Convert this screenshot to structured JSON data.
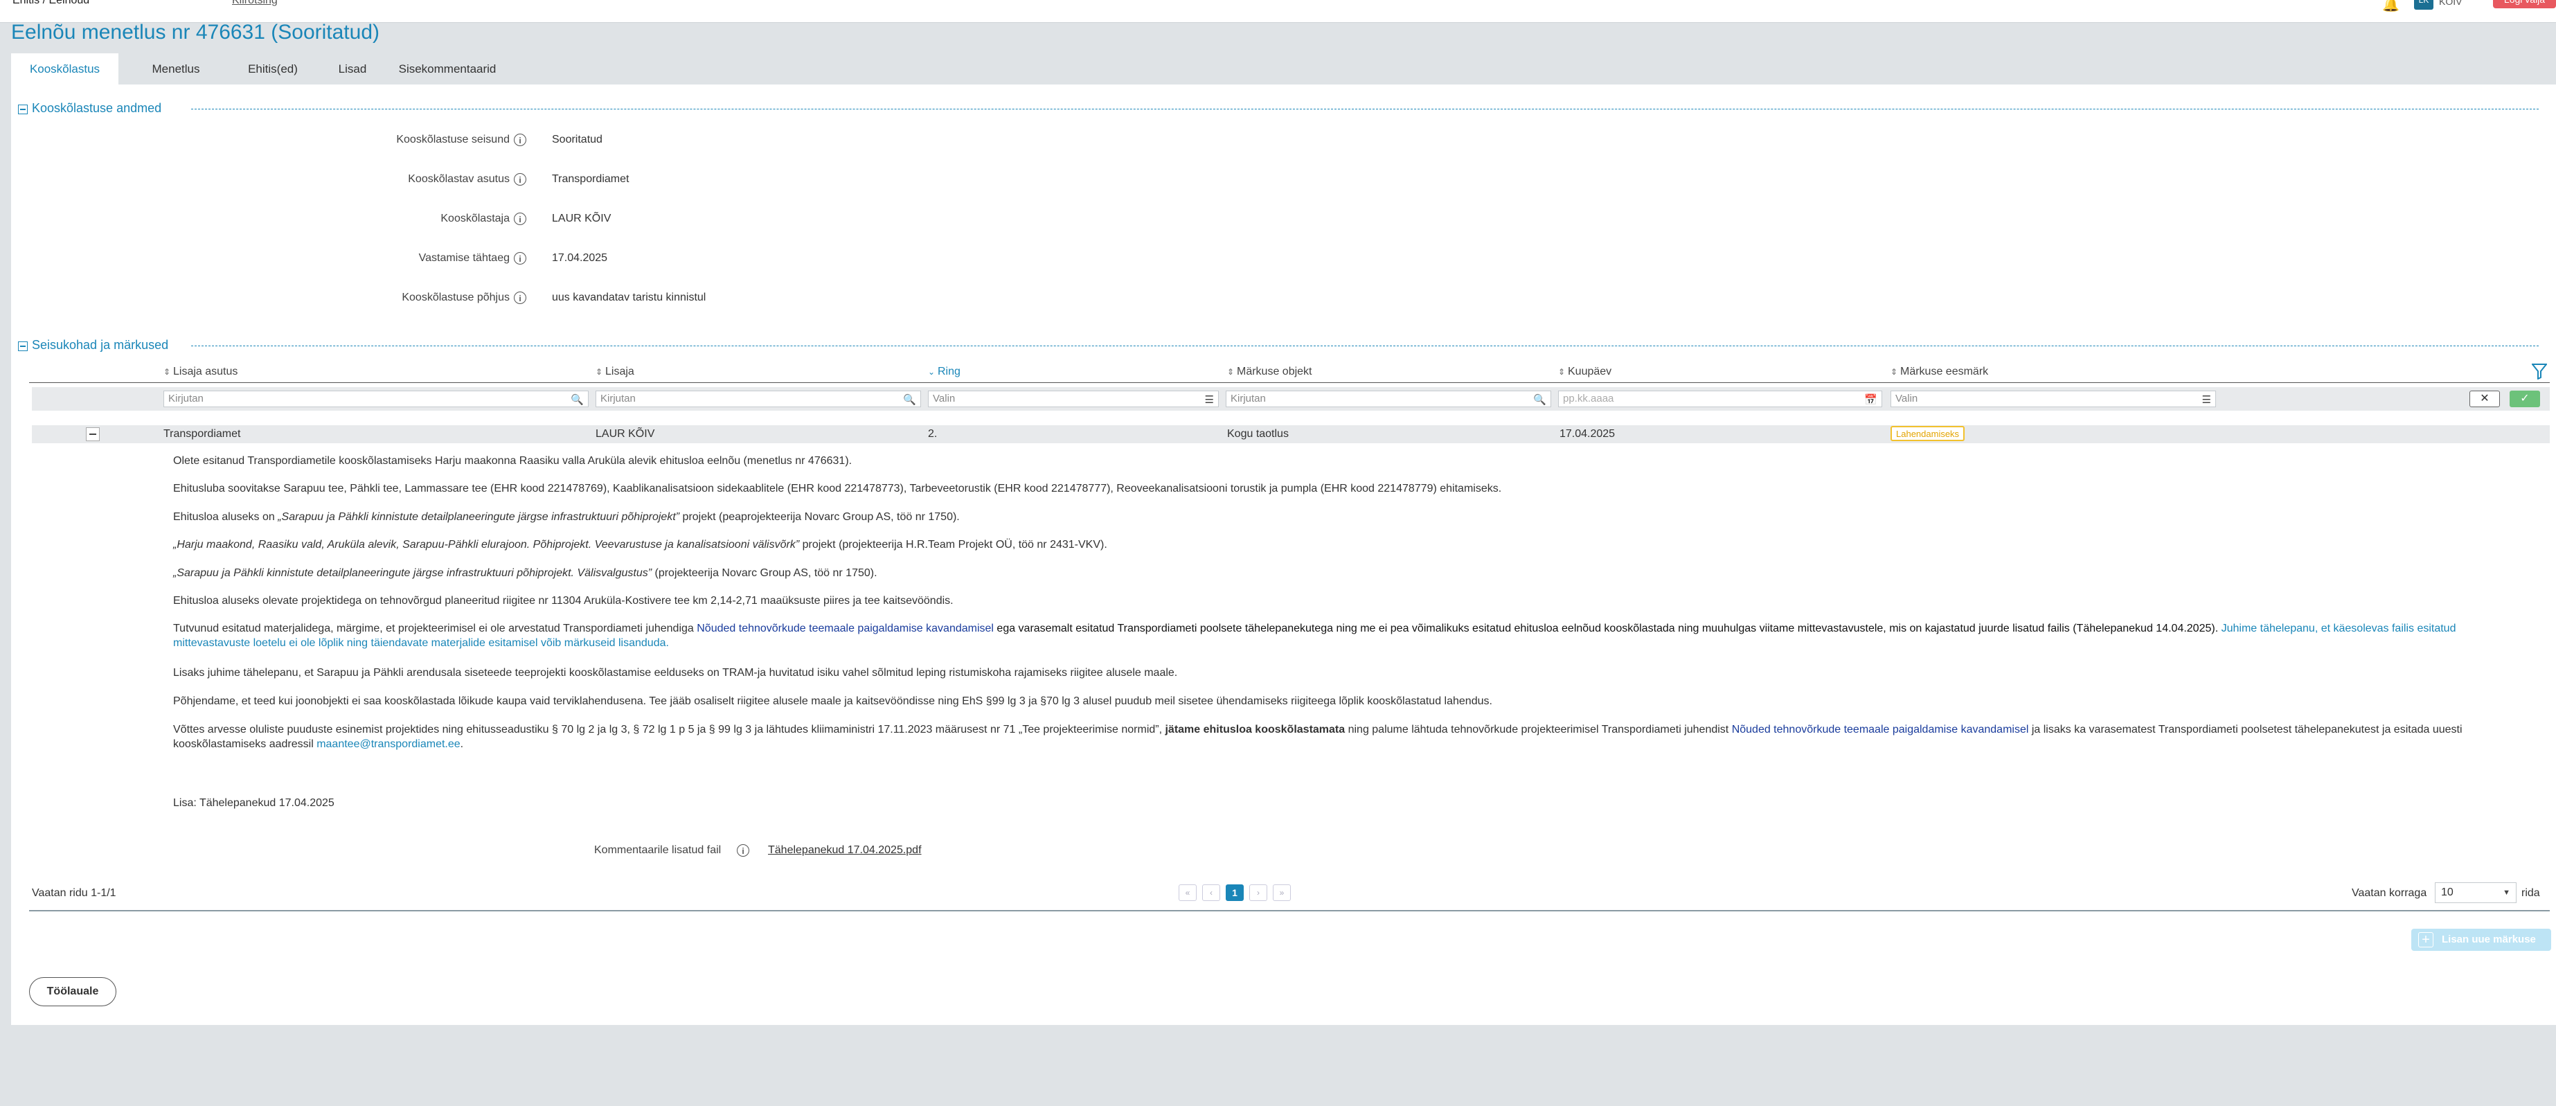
{
  "topbar": {
    "brand": "Ehitis / Eelnõud",
    "search": "Kiirotsing",
    "avatar_initials": "LK",
    "user": "KÕIV",
    "logout": "Logi välja"
  },
  "page": {
    "title": "Eelnõu menetlus nr 476631 (Sooritatud)"
  },
  "tabs": [
    "Kooskõlastus",
    "Menetlus",
    "Ehitis(ed)",
    "Lisad",
    "Sisekommentaarid"
  ],
  "coordination": {
    "section_title": "Kooskõlastuse andmed",
    "fields": [
      {
        "label": "Kooskõlastuse seisund",
        "value": "Sooritatud"
      },
      {
        "label": "Kooskõlastav asutus",
        "value": "Transpordiamet"
      },
      {
        "label": "Kooskõlastaja",
        "value": "LAUR KÕIV"
      },
      {
        "label": "Vastamise tähtaeg",
        "value": "17.04.2025"
      },
      {
        "label": "Kooskõlastuse põhjus",
        "value": "uus kavandatav taristu kinnistul"
      }
    ]
  },
  "remarks": {
    "section_title": "Seisukohad ja märkused",
    "columns": [
      "Lisaja asutus",
      "Lisaja",
      "Ring",
      "Märkuse objekt",
      "Kuupäev",
      "Märkuse eesmärk"
    ],
    "filters": {
      "institution": "Kirjutan",
      "author": "Kirjutan",
      "round": "Valin",
      "object": "Kirjutan",
      "date": "pp.kk.aaaa",
      "purpose": "Valin"
    },
    "row": {
      "institution": "Transpordiamet",
      "author": "LAUR KÕIV",
      "round": "2.",
      "object": "Kogu taotlus",
      "date": "17.04.2025",
      "purpose": "Lahendamiseks"
    },
    "body": {
      "p1": "Olete esitanud Transpordiametile kooskõlastamiseks Harju maakonna Raasiku valla Aruküla alevik ehitusloa eelnõu (menetlus nr 476631).",
      "p2": "Ehitusluba soovitakse Sarapuu tee, Pähkli tee, Lammassare tee (EHR kood 221478769), Kaablikanalisatsioon sidekaablitele (EHR kood 221478773), Tarbeveetorustik (EHR kood 221478777), Reoveekanalisatsiooni torustik ja pumpla (EHR kood 221478779) ehitamiseks.",
      "p3a": "Ehitusloa aluseks on ",
      "p3b": "„Sarapuu ja Pähkli kinnistute detailplaneeringute järgse infrastruktuuri põhiprojekt”",
      "p3c": " projekt (peaprojekteerija Novarc Group AS, töö nr 1750).",
      "p4a": "„Harju maakond, Raasiku vald, Aruküla alevik, Sarapuu-Pähkli elurajoon. Põhiprojekt. Veevarustuse ja kanalisatsiooni välisvõrk”",
      "p4b": " projekt (projekteerija H.R.Team Projekt OÜ, töö nr 2431-VKV).",
      "p5a": "„Sarapuu ja Pähkli kinnistute detailplaneeringute järgse infrastruktuuri põhiprojekt. Välisvalgustus”",
      "p5b": " (projekteerija Novarc Group AS, töö nr 1750).",
      "p6": "Ehitusloa aluseks olevate projektidega on tehnovõrgud planeeritud riigitee nr 11304 Aruküla-Kostivere tee km 2,14-2,71 maaüksuste piires ja tee kaitsevööndis.",
      "p7a": "Tutvunud esitatud materjalidega, märgime, et projekteerimisel ei ole arvestatud Transpordiameti juhendiga ",
      "p7b": "Nõuded tehnovõrkude teemaale paigaldamise kavandamisel",
      "p7c": " ega varasemalt esitatud Transpordiameti poolsete tähelepanekutega ning me ei pea võimalikuks esitatud ehitusloa eelnõud kooskõlastada ning muuhulgas viitame mittevastavustele, mis on kajastatud juurde lisatud failis (Tähelepanekud 14.04.2025).",
      "p7d": " Juhime tähelepanu, et käesolevas failis esitatud mittevastavuste loetelu ei ole lõplik ning täiendavate materjalide esitamisel võib märkuseid lisanduda.",
      "p8": "Lisaks juhime tähelepanu, et Sarapuu ja Pähkli arendusala siseteede teeprojekti kooskõlastamise eelduseks on TRAM-ja huvitatud isiku vahel sõlmitud leping ristumiskoha rajamiseks riigitee alusele maale.",
      "p9": "Põhjendame, et teed kui joonobjekti ei saa kooskõlastada lõikude kaupa vaid terviklahendusena. Tee jääb osaliselt riigitee alusele maale ja kaitsevööndisse ning EhS §99 lg 3 ja §70 lg 3 alusel puudub meil sisetee ühendamiseks riigiteega lõplik kooskõlastatud lahendus.",
      "p10a": "Võttes arvesse oluliste puuduste esinemist projektides ning ehitusseadustiku § 70 lg 2 ja lg 3, § 72 lg 1 p 5 ja § 99 lg 3 ja lähtudes kliimaministri 17.11.2023 määrusest nr 71 „Tee projekteerimise normid”, ",
      "p10b": "jätame ehitusloa kooskõlastamata",
      "p10c": " ning palume lähtuda tehnovõrkude projekteerimisel Transpordiameti juhendist ",
      "p10d": "Nõuded tehnovõrkude teemaale paigaldamise kavandamisel",
      "p10e": " ja lisaks ka varasematest Transpordiameti poolsetest tähelepanekutest ja esitada uuesti kooskõlastamiseks aadressil ",
      "p10f": "maantee@transpordiamet.ee",
      "p10g": ".",
      "p11": "Lisa: Tähelepanekud 17.04.2025"
    },
    "attachment_label": "Kommentaarile lisatud fail",
    "attachment_file": "Tähelepanekud 17.04.2025.pdf"
  },
  "pager": {
    "summary": "Vaatan ridu 1-1/1",
    "current_page": "1",
    "per_page_label": "Vaatan korraga",
    "per_page_value": "10",
    "rows_suffix": "rida"
  },
  "actions": {
    "add_remark": "Lisan uue märkuse",
    "back": "Töölauale"
  },
  "colors": {
    "accent": "#1a86b8",
    "badge": "#f2c12e",
    "confirm": "#6cc27a"
  }
}
